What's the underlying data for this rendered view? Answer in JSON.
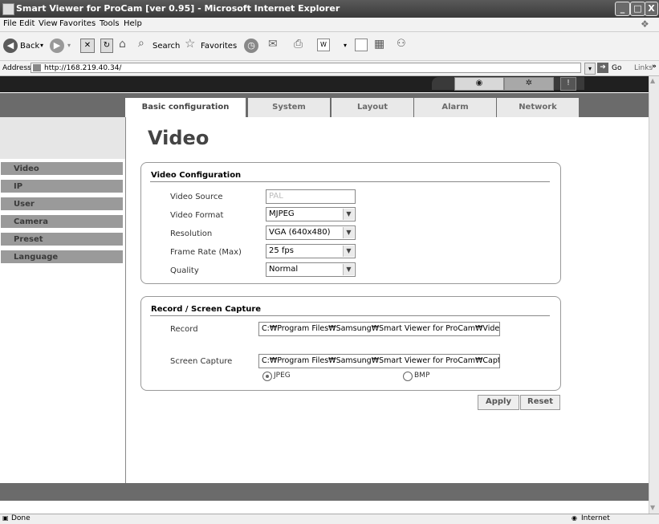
{
  "window": {
    "title": "Smart Viewer for ProCam [ver 0.95] - Microsoft Internet Explorer",
    "minimize": "_",
    "maximize": "□",
    "close": "X"
  },
  "menu": [
    "File",
    "Edit",
    "View",
    "Favorites",
    "Tools",
    "Help"
  ],
  "toolbar": {
    "back": "Back",
    "search": "Search",
    "favorites": "Favorites"
  },
  "address": {
    "label": "Address",
    "url": "http://168.219.40.34/",
    "go": "Go",
    "links": "Links"
  },
  "nav_tabs": [
    "Basic configuration",
    "System",
    "Layout",
    "Alarm",
    "Network"
  ],
  "sidebar": [
    "Video",
    "IP",
    "User",
    "Camera",
    "Preset",
    "Language"
  ],
  "page_title": "Video",
  "video_config": {
    "title": "Video Configuration",
    "rows": [
      {
        "label": "Video Source",
        "value": "PAL"
      },
      {
        "label": "Video Format",
        "value": "MJPEG"
      },
      {
        "label": "Resolution",
        "value": "VGA (640x480)"
      },
      {
        "label": "Frame Rate (Max)",
        "value": "25 fps"
      },
      {
        "label": "Quality",
        "value": "Normal"
      }
    ]
  },
  "record": {
    "title": "Record / Screen Capture",
    "record_label": "Record",
    "record_path": "C:₩Program Files₩Samsung₩Smart Viewer for ProCam₩Video",
    "capture_label": "Screen Capture",
    "capture_path": "C:₩Program Files₩Samsung₩Smart Viewer for ProCam₩Captu",
    "formats": [
      "JPEG",
      "BMP"
    ],
    "selected_format": "JPEG"
  },
  "buttons": {
    "apply": "Apply",
    "reset": "Reset"
  },
  "status": {
    "left": "Done",
    "right": "Internet"
  }
}
